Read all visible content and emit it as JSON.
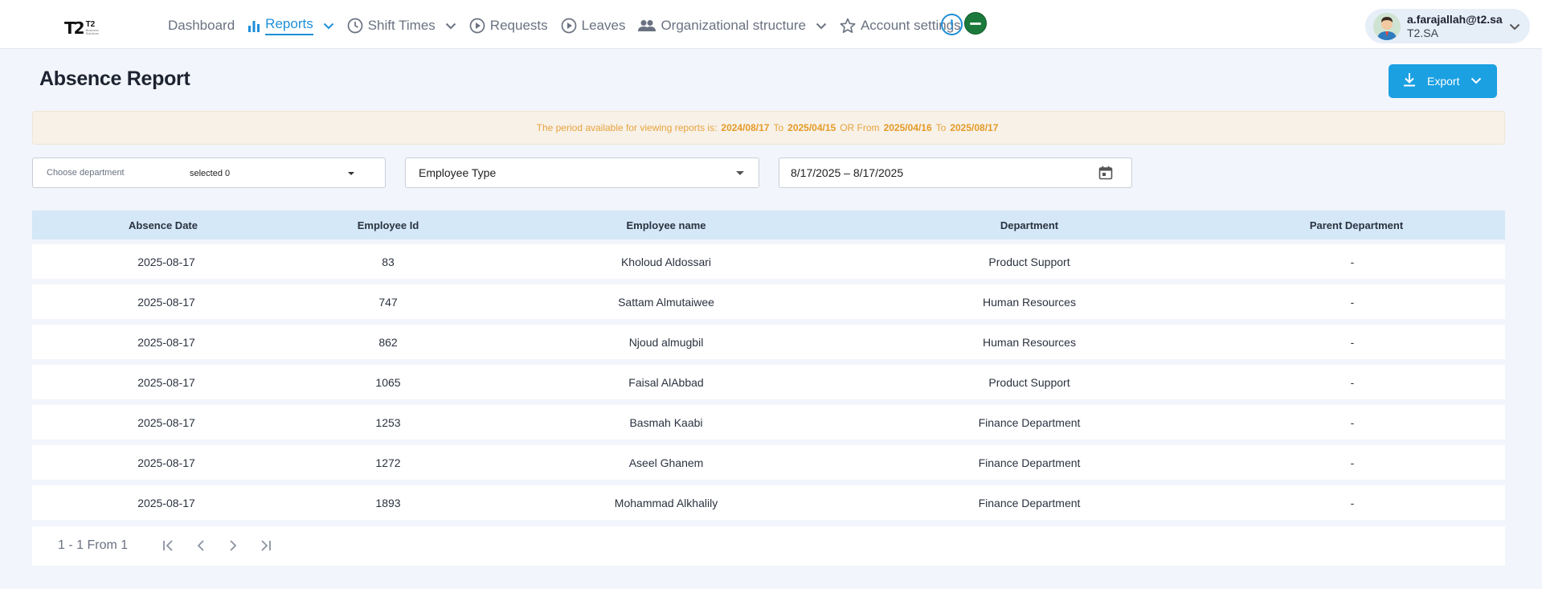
{
  "brand": {
    "logo_mark": "T2",
    "logo_text": "T2",
    "logo_sub": "Business Solutions"
  },
  "nav": {
    "items": [
      {
        "label": "Dashboard",
        "icon": "none",
        "has_dropdown": false,
        "active": false
      },
      {
        "label": "Reports",
        "icon": "bar-chart-icon",
        "has_dropdown": true,
        "active": true
      },
      {
        "label": "Shift Times",
        "icon": "clock-icon",
        "has_dropdown": true,
        "active": false
      },
      {
        "label": "Requests",
        "icon": "play-circle-icon",
        "has_dropdown": false,
        "active": false
      },
      {
        "label": "Leaves",
        "icon": "play-circle-icon",
        "has_dropdown": false,
        "active": false
      },
      {
        "label": "Organizational structure",
        "icon": "people-icon",
        "has_dropdown": true,
        "active": false
      },
      {
        "label": "Account settings",
        "icon": "star-icon",
        "has_dropdown": true,
        "active": false
      }
    ],
    "alert_symbol": "!"
  },
  "user": {
    "email": "a.farajallah@t2.sa",
    "org": "T2.SA"
  },
  "page": {
    "title": "Absence Report",
    "export_label": "Export"
  },
  "notice": {
    "prefix": "The period available for viewing reports is:",
    "from1": "2024/08/17",
    "to_word": "To",
    "to1": "2025/04/15",
    "or_from": "OR From",
    "from2": "2025/04/16",
    "to_word2": "To",
    "to2": "2025/08/17"
  },
  "filters": {
    "department": {
      "placeholder": "Choose department",
      "selected": "selected 0"
    },
    "employee_type": {
      "placeholder": "Employee Type"
    },
    "date_range": {
      "value": "8/17/2025 – 8/17/2025"
    }
  },
  "table": {
    "columns": [
      "Absence Date",
      "Employee Id",
      "Employee name",
      "Department",
      "Parent Department"
    ],
    "rows": [
      [
        "2025-08-17",
        "83",
        "Kholoud Aldossari",
        "Product Support",
        "-"
      ],
      [
        "2025-08-17",
        "747",
        "Sattam Almutaiwee",
        "Human Resources",
        "-"
      ],
      [
        "2025-08-17",
        "862",
        "Njoud almugbil",
        "Human Resources",
        "-"
      ],
      [
        "2025-08-17",
        "1065",
        "Faisal AlAbbad",
        "Product Support",
        "-"
      ],
      [
        "2025-08-17",
        "1253",
        "Basmah Kaabi",
        "Finance Department",
        "-"
      ],
      [
        "2025-08-17",
        "1272",
        "Aseel Ghanem",
        "Finance Department",
        "-"
      ],
      [
        "2025-08-17",
        "1893",
        "Mohammad Alkhalily",
        "Finance Department",
        "-"
      ]
    ]
  },
  "pagination": {
    "info": "1 - 1 From 1"
  },
  "colors": {
    "accent": "#1e8fd8",
    "export_bg": "#1ba0e2",
    "notice_text": "#e8a33c",
    "table_header_bg": "#d4e8f7",
    "page_bg": "#f2f5fb"
  }
}
